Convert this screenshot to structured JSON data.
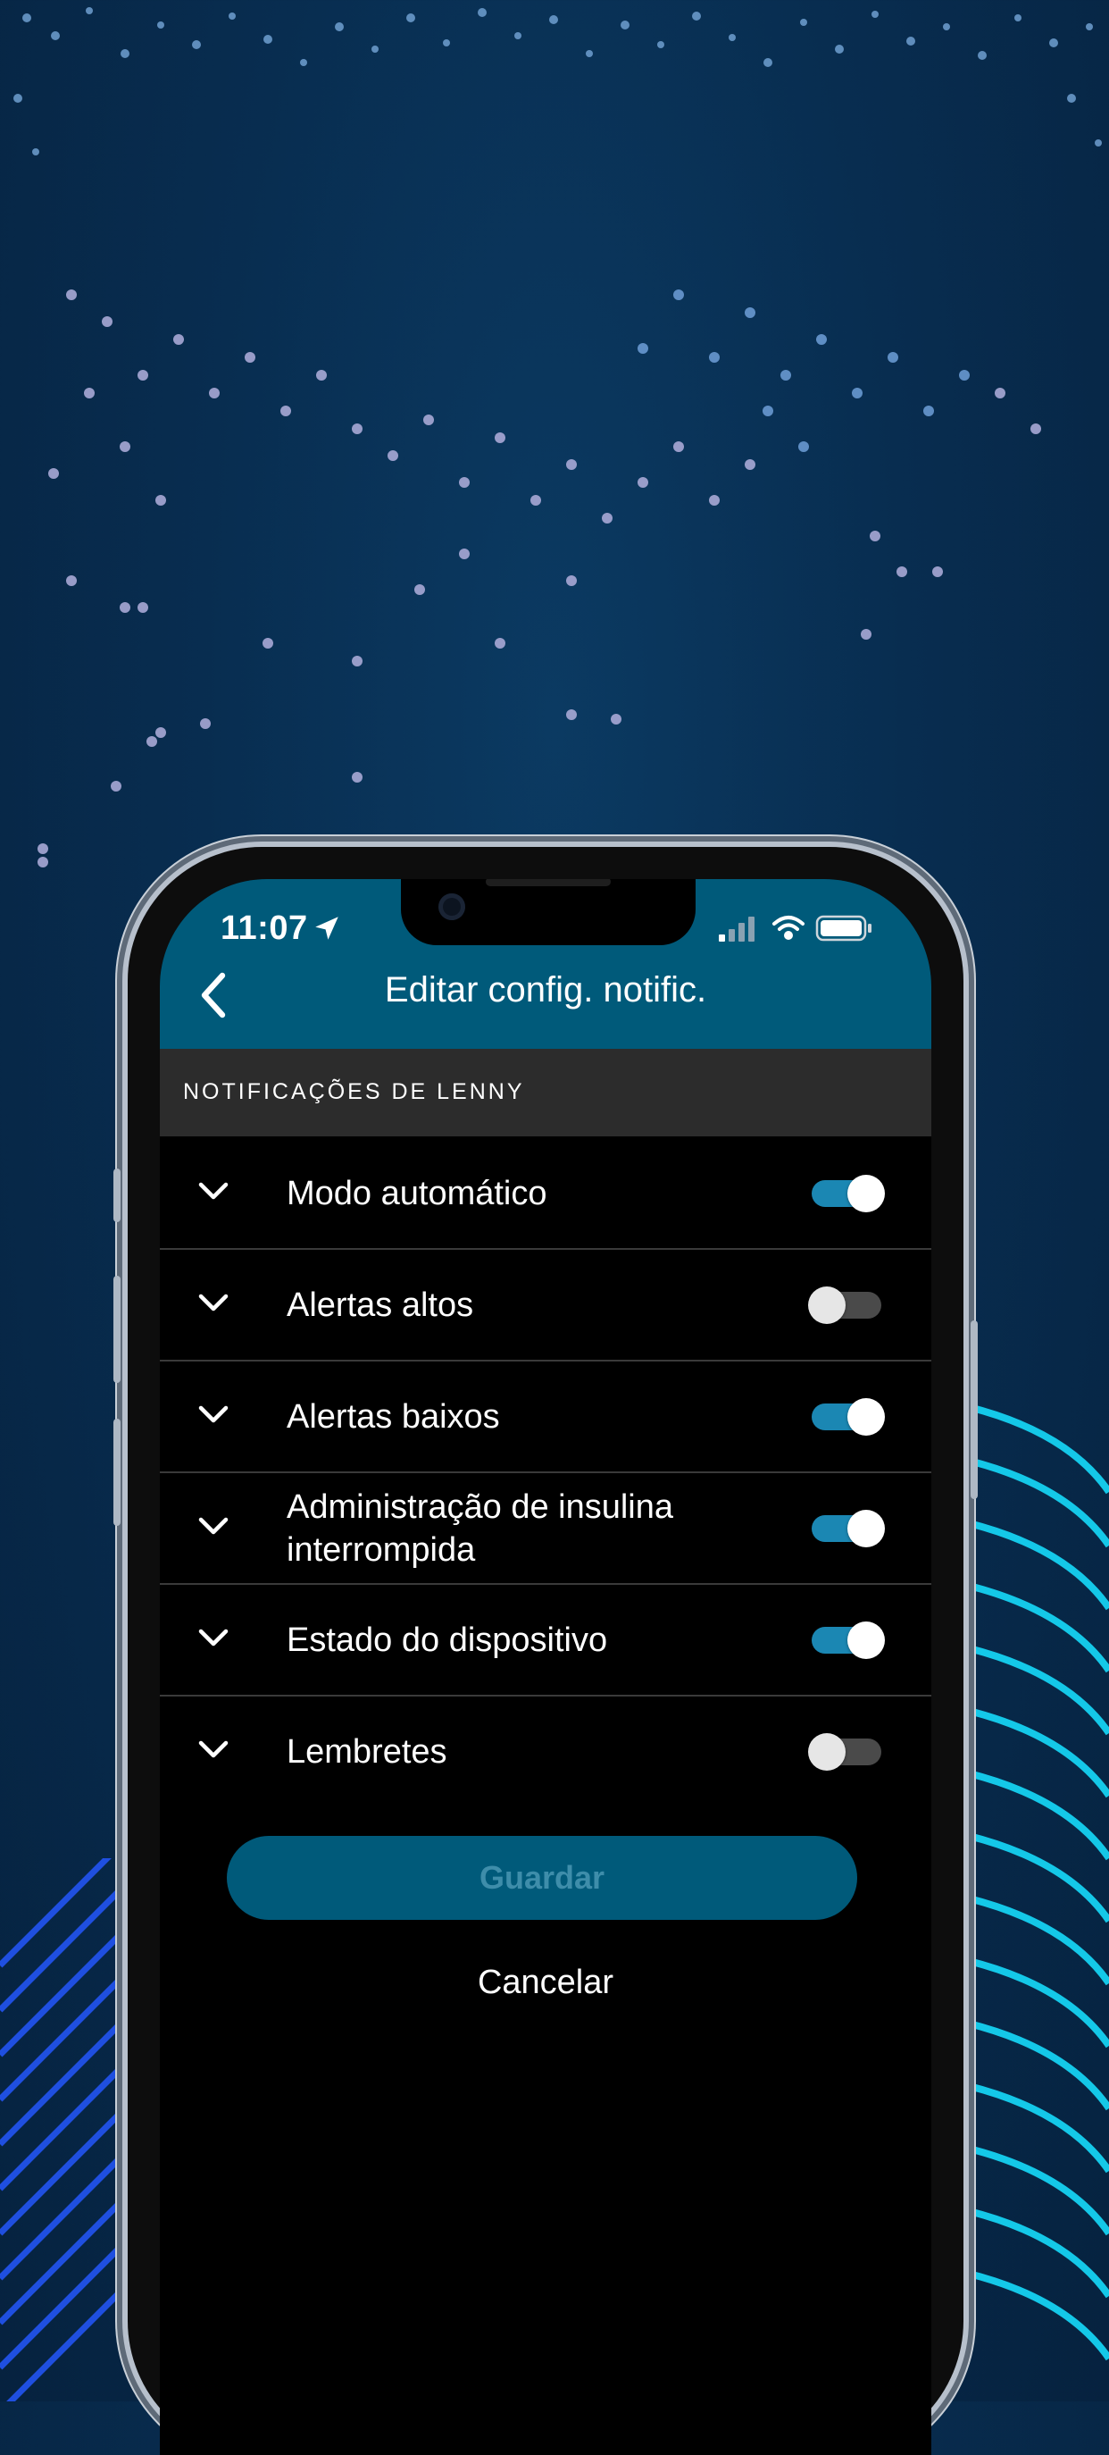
{
  "status_bar": {
    "time": "11:07"
  },
  "nav": {
    "title": "Editar config. notific."
  },
  "section": {
    "header": "NOTIFICAÇÕES DE LENNY"
  },
  "rows": [
    {
      "label": "Modo automático",
      "enabled": true
    },
    {
      "label": "Alertas altos",
      "enabled": false
    },
    {
      "label": "Alertas baixos",
      "enabled": true
    },
    {
      "label": "Administração de insulina interrompida",
      "enabled": true
    },
    {
      "label": "Estado do dispositivo",
      "enabled": true
    },
    {
      "label": "Lembretes",
      "enabled": false
    }
  ],
  "actions": {
    "save_label": "Guardar",
    "cancel_label": "Cancelar"
  },
  "colors": {
    "accent": "#005a7a",
    "toggle_on": "#1b87b3",
    "background": "#082d50"
  }
}
